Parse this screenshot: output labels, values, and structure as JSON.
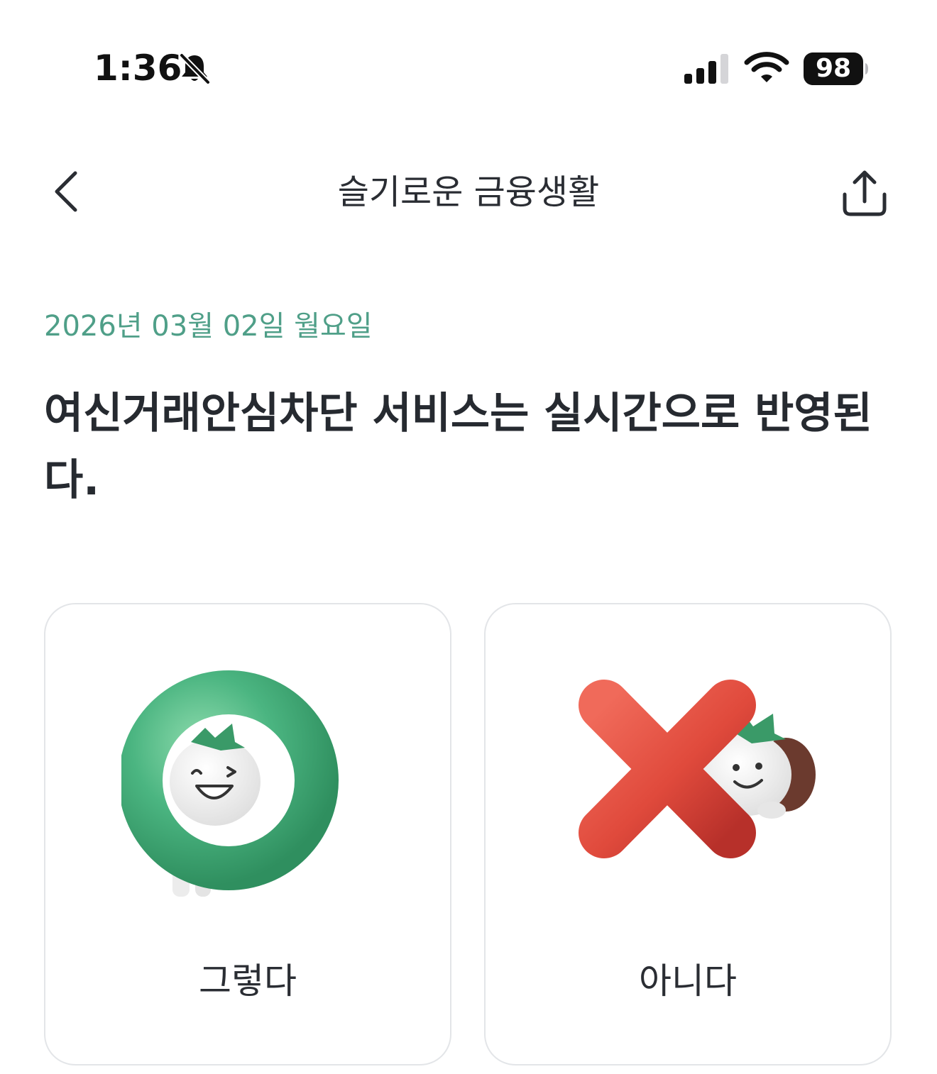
{
  "status_bar": {
    "time": "1:36",
    "battery_level": "98",
    "icons": [
      "bell-slash-icon",
      "cellular-signal-icon",
      "wifi-icon",
      "battery-icon"
    ]
  },
  "header": {
    "title": "슬기로운 금융생활",
    "back_icon": "chevron-left-icon",
    "share_icon": "share-icon"
  },
  "quiz": {
    "date": "2026년 03월 02일 월요일",
    "question": "여신거래안심차단 서비스는 실시간으로 반영된다.",
    "choices": [
      {
        "label": "그렇다",
        "icon": "o-mark-icon",
        "color": "#4bb581"
      },
      {
        "label": "아니다",
        "icon": "x-mark-icon",
        "color": "#e04a3c"
      }
    ]
  },
  "colors": {
    "accent": "#4f9f88",
    "text": "#262a30",
    "card_border": "#e3e5e8"
  }
}
